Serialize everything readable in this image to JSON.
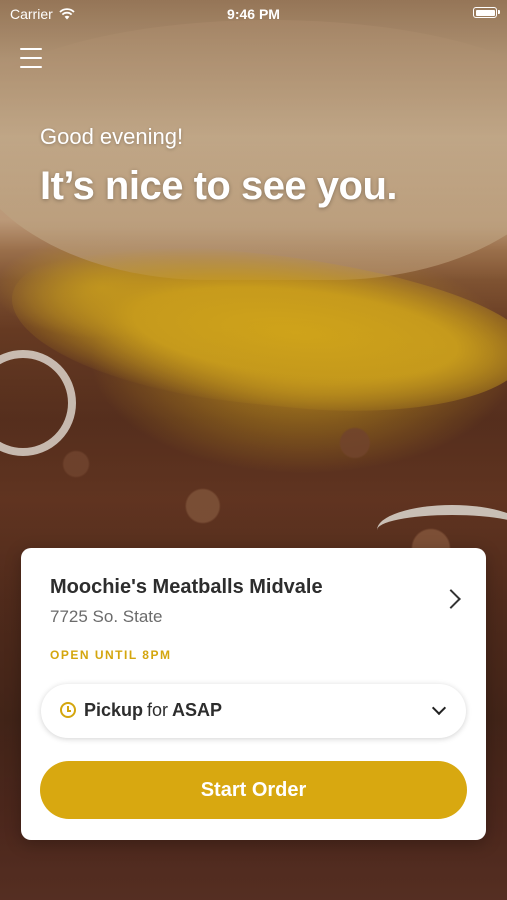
{
  "status_bar": {
    "carrier": "Carrier",
    "time": "9:46 PM"
  },
  "header": {
    "menu_icon": "hamburger-menu-icon"
  },
  "hero": {
    "greeting": "Good evening!",
    "headline": "It’s nice to see you."
  },
  "store_card": {
    "name": "Moochie's Meatballs Midvale",
    "address": "7725 So. State",
    "status": "OPEN UNTIL 8PM",
    "order_mode": "Pickup",
    "for_label": "for",
    "order_time": "ASAP",
    "start_order_label": "Start Order"
  },
  "colors": {
    "accent": "#d8a810",
    "status_text": "#d4a60e"
  }
}
